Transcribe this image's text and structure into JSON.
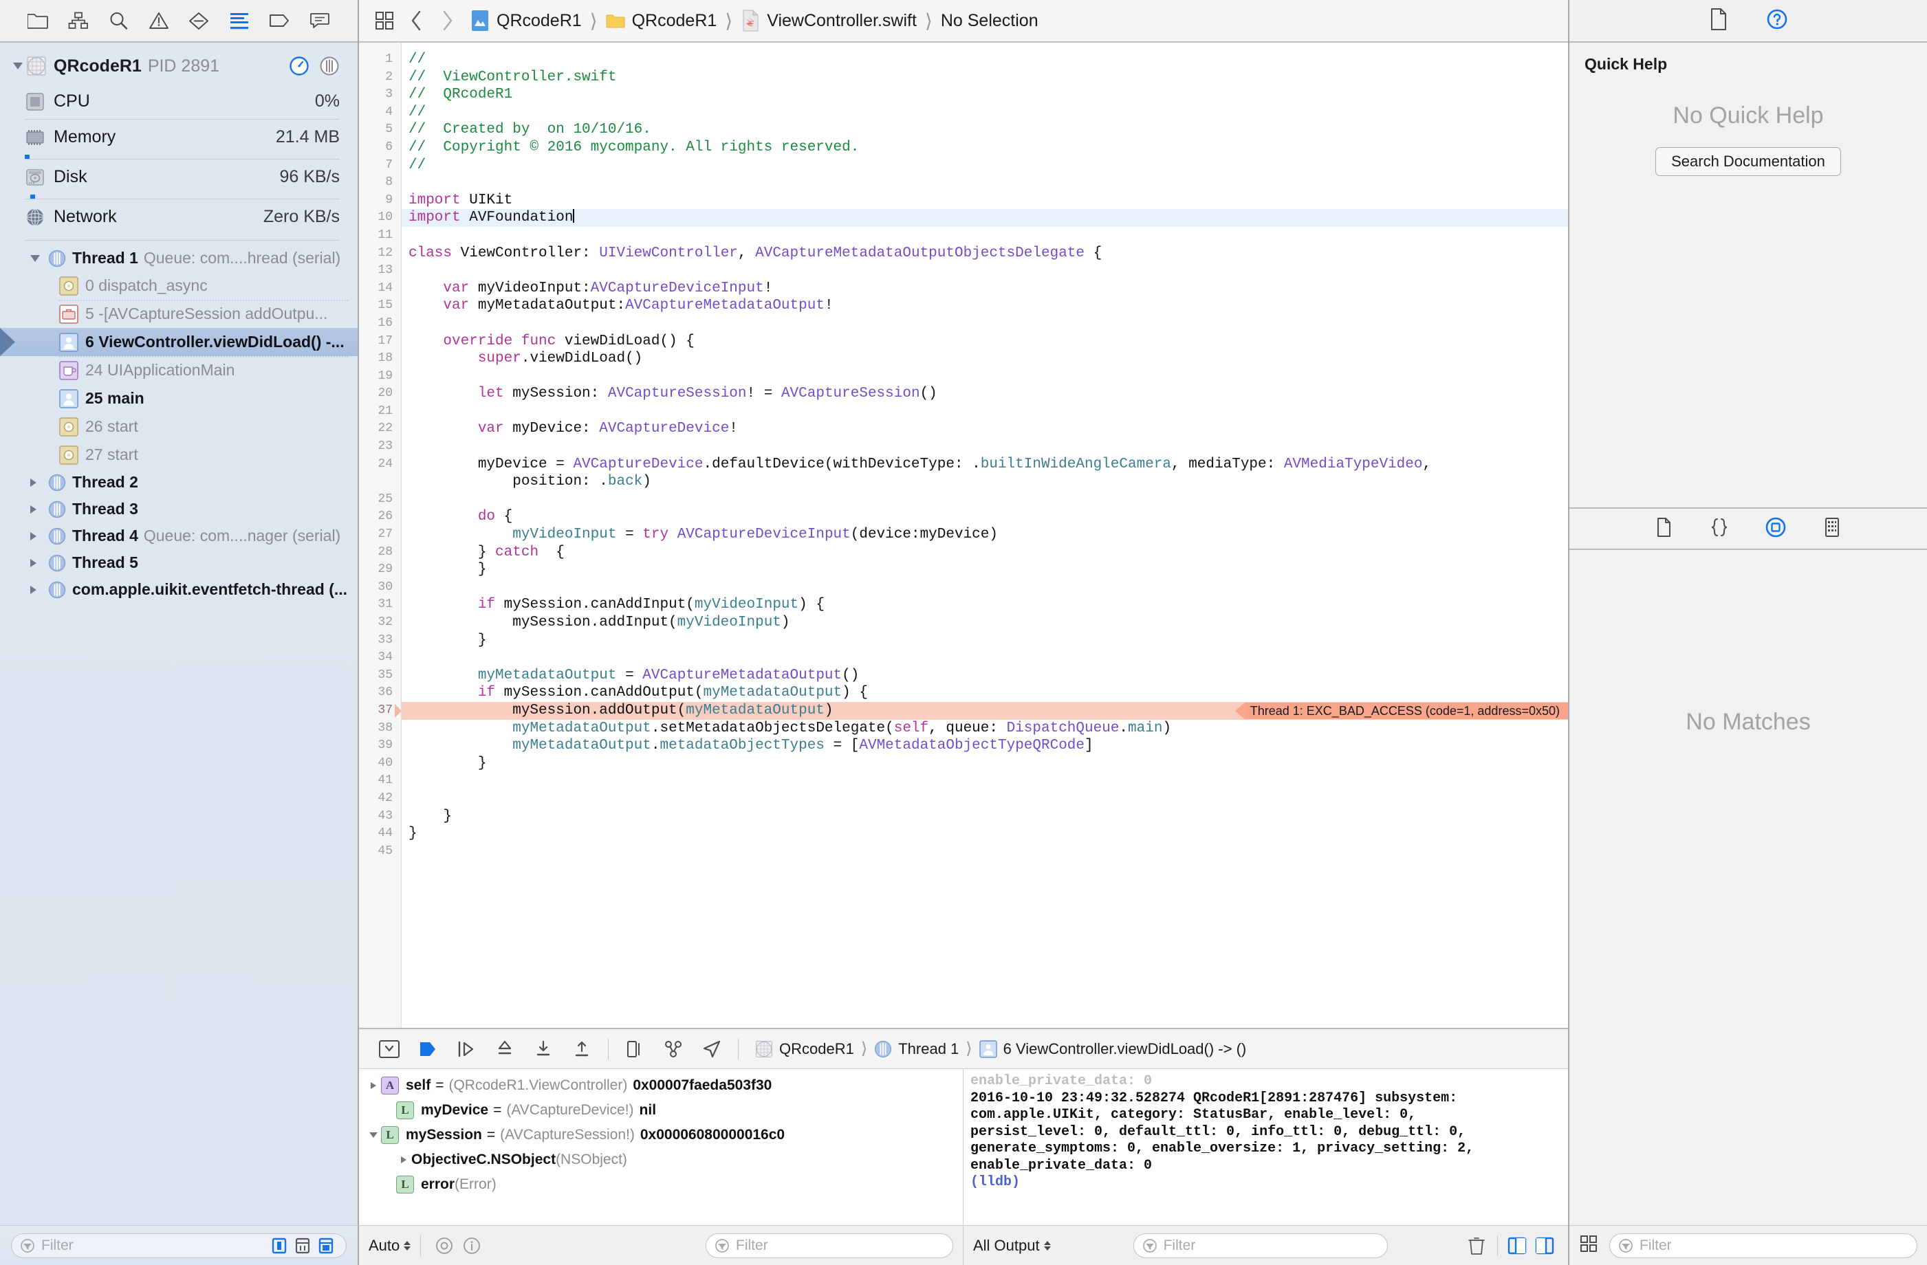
{
  "navigator": {
    "tabs": [
      {
        "name": "folder-icon",
        "label": "Project navigator"
      },
      {
        "name": "hierarchy-icon",
        "label": "Source control navigator"
      },
      {
        "name": "search-icon",
        "label": "Find navigator"
      },
      {
        "name": "warning-triangle-icon",
        "label": "Issue navigator"
      },
      {
        "name": "test-diamond-icon",
        "label": "Test navigator"
      },
      {
        "name": "debug-list-icon",
        "label": "Debug navigator"
      },
      {
        "name": "tag-icon",
        "label": "Breakpoint navigator"
      },
      {
        "name": "speech-bubble-icon",
        "label": "Report navigator"
      }
    ],
    "selected_tab": 5,
    "process": {
      "name": "QRcodeR1",
      "pid_label": "PID 2891",
      "gauge_icon": "gauge-icon",
      "threads_icon": "threads-icon"
    },
    "gauges": [
      {
        "icon": "cpu-icon",
        "label": "CPU",
        "value": "0%",
        "meter": 0
      },
      {
        "icon": "memory-icon",
        "label": "Memory",
        "value": "21.4 MB",
        "meter": 2
      },
      {
        "icon": "disk-icon",
        "label": "Disk",
        "value": "96 KB/s",
        "meter": 2
      },
      {
        "icon": "network-icon",
        "label": "Network",
        "value": "Zero KB/s",
        "meter": 0
      }
    ],
    "threads": [
      {
        "name": "Thread 1",
        "queue": "Queue: com....hread (serial)",
        "expanded": true,
        "frames": [
          {
            "num": "0",
            "label": "dispatch_async",
            "icon": "gear-frame-icon",
            "style": "gray",
            "divider": false
          },
          {
            "num": "5",
            "label": "-[AVCaptureSession addOutpu...",
            "icon": "library-frame-icon",
            "style": "gray",
            "divider": true
          },
          {
            "num": "6",
            "label": "ViewController.viewDidLoad() -...",
            "icon": "user-frame-icon",
            "style": "selected",
            "divider": false
          },
          {
            "num": "24",
            "label": "UIApplicationMain",
            "icon": "coffee-frame-icon",
            "style": "gray",
            "divider": true
          },
          {
            "num": "25",
            "label": "main",
            "icon": "user-frame-icon",
            "style": "dark",
            "divider": false
          },
          {
            "num": "26",
            "label": "start",
            "icon": "gear-frame-icon",
            "style": "gray",
            "divider": false
          },
          {
            "num": "27",
            "label": "start",
            "icon": "gear-frame-icon",
            "style": "gray",
            "divider": false
          }
        ]
      },
      {
        "name": "Thread 2",
        "queue": "",
        "expanded": false,
        "frames": []
      },
      {
        "name": "Thread 3",
        "queue": "",
        "expanded": false,
        "frames": []
      },
      {
        "name": "Thread 4",
        "queue": "Queue: com....nager (serial)",
        "expanded": false,
        "frames": []
      },
      {
        "name": "Thread 5",
        "queue": "",
        "expanded": false,
        "frames": []
      },
      {
        "name": "com.apple.uikit.eventfetch-thread (...",
        "queue": "",
        "expanded": false,
        "frames": []
      }
    ],
    "filter_placeholder": "Filter"
  },
  "editor": {
    "jump_bar": {
      "related_items_icon": "related-items-icon",
      "back_icon": "chevron-left-icon",
      "forward_icon": "chevron-right-icon",
      "crumbs": [
        {
          "label": "QRcodeR1",
          "icon": "xcode-project-icon"
        },
        {
          "label": "QRcodeR1",
          "icon": "folder-icon"
        },
        {
          "label": "ViewController.swift",
          "icon": "swift-file-icon"
        },
        {
          "label": "No Selection",
          "icon": ""
        }
      ]
    },
    "first_line": 1,
    "lines": [
      {
        "n": 1,
        "tokens": [
          {
            "t": "//",
            "c": "cmt"
          }
        ]
      },
      {
        "n": 2,
        "tokens": [
          {
            "t": "//  ViewController.swift",
            "c": "cmt"
          }
        ]
      },
      {
        "n": 3,
        "tokens": [
          {
            "t": "//  QRcodeR1",
            "c": "cmt"
          }
        ]
      },
      {
        "n": 4,
        "tokens": [
          {
            "t": "//",
            "c": "cmt"
          }
        ]
      },
      {
        "n": 5,
        "tokens": [
          {
            "t": "//  Created by  on 10/10/16.",
            "c": "cmt"
          }
        ]
      },
      {
        "n": 6,
        "tokens": [
          {
            "t": "//  Copyright © 2016 mycompany. All rights reserved.",
            "c": "cmt"
          }
        ]
      },
      {
        "n": 7,
        "tokens": [
          {
            "t": "//",
            "c": "cmt"
          }
        ]
      },
      {
        "n": 8,
        "tokens": []
      },
      {
        "n": 9,
        "tokens": [
          {
            "t": "import",
            "c": "kw"
          },
          {
            "t": " UIKit",
            "c": "pln"
          }
        ]
      },
      {
        "n": 10,
        "tokens": [
          {
            "t": "import",
            "c": "kw"
          },
          {
            "t": " AVFoundation",
            "c": "pln"
          }
        ],
        "highlight": true,
        "caret": true
      },
      {
        "n": 11,
        "tokens": []
      },
      {
        "n": 12,
        "tokens": [
          {
            "t": "class",
            "c": "kw"
          },
          {
            "t": " ViewController: ",
            "c": "pln"
          },
          {
            "t": "UIViewController",
            "c": "typ"
          },
          {
            "t": ", ",
            "c": "pln"
          },
          {
            "t": "AVCaptureMetadataOutputObjectsDelegate",
            "c": "typ"
          },
          {
            "t": " {",
            "c": "pln"
          }
        ]
      },
      {
        "n": 13,
        "tokens": []
      },
      {
        "n": 14,
        "tokens": [
          {
            "t": "    ",
            "c": "pln"
          },
          {
            "t": "var",
            "c": "kw"
          },
          {
            "t": " myVideoInput:",
            "c": "pln"
          },
          {
            "t": "AVCaptureDeviceInput",
            "c": "typ"
          },
          {
            "t": "!",
            "c": "pln"
          }
        ]
      },
      {
        "n": 15,
        "tokens": [
          {
            "t": "    ",
            "c": "pln"
          },
          {
            "t": "var",
            "c": "kw"
          },
          {
            "t": " myMetadataOutput:",
            "c": "pln"
          },
          {
            "t": "AVCaptureMetadataOutput",
            "c": "typ"
          },
          {
            "t": "!",
            "c": "pln"
          }
        ]
      },
      {
        "n": 16,
        "tokens": []
      },
      {
        "n": 17,
        "tokens": [
          {
            "t": "    ",
            "c": "pln"
          },
          {
            "t": "override func",
            "c": "kw"
          },
          {
            "t": " viewDidLoad() {",
            "c": "pln"
          }
        ]
      },
      {
        "n": 18,
        "tokens": [
          {
            "t": "        ",
            "c": "pln"
          },
          {
            "t": "super",
            "c": "kw"
          },
          {
            "t": ".viewDidLoad()",
            "c": "pln"
          }
        ]
      },
      {
        "n": 19,
        "tokens": []
      },
      {
        "n": 20,
        "tokens": [
          {
            "t": "        ",
            "c": "pln"
          },
          {
            "t": "let",
            "c": "kw"
          },
          {
            "t": " mySession: ",
            "c": "pln"
          },
          {
            "t": "AVCaptureSession",
            "c": "typ"
          },
          {
            "t": "! = ",
            "c": "pln"
          },
          {
            "t": "AVCaptureSession",
            "c": "typ"
          },
          {
            "t": "()",
            "c": "pln"
          }
        ]
      },
      {
        "n": 21,
        "tokens": []
      },
      {
        "n": 22,
        "tokens": [
          {
            "t": "        ",
            "c": "pln"
          },
          {
            "t": "var",
            "c": "kw"
          },
          {
            "t": " myDevice: ",
            "c": "pln"
          },
          {
            "t": "AVCaptureDevice",
            "c": "typ"
          },
          {
            "t": "!",
            "c": "pln"
          }
        ]
      },
      {
        "n": 23,
        "tokens": []
      },
      {
        "n": 24,
        "tokens": [
          {
            "t": "        myDevice = ",
            "c": "pln"
          },
          {
            "t": "AVCaptureDevice",
            "c": "typ"
          },
          {
            "t": ".defaultDevice(withDeviceType: .",
            "c": "pln"
          },
          {
            "t": "builtInWideAngleCamera",
            "c": "mem"
          },
          {
            "t": ", mediaType: ",
            "c": "pln"
          },
          {
            "t": "AVMediaTypeVideo",
            "c": "typ"
          },
          {
            "t": ",",
            "c": "pln"
          }
        ]
      },
      {
        "n": 0,
        "tokens": [
          {
            "t": "            position: .",
            "c": "pln"
          },
          {
            "t": "back",
            "c": "mem"
          },
          {
            "t": ")",
            "c": "pln"
          }
        ],
        "continuation": true
      },
      {
        "n": 25,
        "tokens": []
      },
      {
        "n": 26,
        "tokens": [
          {
            "t": "        ",
            "c": "pln"
          },
          {
            "t": "do",
            "c": "kw"
          },
          {
            "t": " {",
            "c": "pln"
          }
        ]
      },
      {
        "n": 27,
        "tokens": [
          {
            "t": "            ",
            "c": "pln"
          },
          {
            "t": "myVideoInput",
            "c": "mem"
          },
          {
            "t": " = ",
            "c": "pln"
          },
          {
            "t": "try",
            "c": "kw"
          },
          {
            "t": " ",
            "c": "pln"
          },
          {
            "t": "AVCaptureDeviceInput",
            "c": "typ"
          },
          {
            "t": "(device:myDevice)",
            "c": "pln"
          }
        ]
      },
      {
        "n": 28,
        "tokens": [
          {
            "t": "        } ",
            "c": "pln"
          },
          {
            "t": "catch",
            "c": "kw"
          },
          {
            "t": "  {",
            "c": "pln"
          }
        ]
      },
      {
        "n": 29,
        "tokens": [
          {
            "t": "        }",
            "c": "pln"
          }
        ]
      },
      {
        "n": 30,
        "tokens": []
      },
      {
        "n": 31,
        "tokens": [
          {
            "t": "        ",
            "c": "pln"
          },
          {
            "t": "if",
            "c": "kw"
          },
          {
            "t": " mySession.canAddInput(",
            "c": "pln"
          },
          {
            "t": "myVideoInput",
            "c": "mem"
          },
          {
            "t": ") {",
            "c": "pln"
          }
        ]
      },
      {
        "n": 32,
        "tokens": [
          {
            "t": "            mySession.addInput(",
            "c": "pln"
          },
          {
            "t": "myVideoInput",
            "c": "mem"
          },
          {
            "t": ")",
            "c": "pln"
          }
        ]
      },
      {
        "n": 33,
        "tokens": [
          {
            "t": "        }",
            "c": "pln"
          }
        ]
      },
      {
        "n": 34,
        "tokens": []
      },
      {
        "n": 35,
        "tokens": [
          {
            "t": "        ",
            "c": "pln"
          },
          {
            "t": "myMetadataOutput",
            "c": "mem"
          },
          {
            "t": " = ",
            "c": "pln"
          },
          {
            "t": "AVCaptureMetadataOutput",
            "c": "typ"
          },
          {
            "t": "()",
            "c": "pln"
          }
        ]
      },
      {
        "n": 36,
        "tokens": [
          {
            "t": "        ",
            "c": "pln"
          },
          {
            "t": "if",
            "c": "kw"
          },
          {
            "t": " mySession.canAddOutput(",
            "c": "pln"
          },
          {
            "t": "myMetadataOutput",
            "c": "mem"
          },
          {
            "t": ") {",
            "c": "pln"
          }
        ]
      },
      {
        "n": 37,
        "tokens": [
          {
            "t": "            mySession.addOutput(",
            "c": "pln"
          },
          {
            "t": "myMetadataOutput",
            "c": "mem"
          },
          {
            "t": ")",
            "c": "pln"
          }
        ],
        "error": true
      },
      {
        "n": 38,
        "tokens": [
          {
            "t": "            ",
            "c": "pln"
          },
          {
            "t": "myMetadataOutput",
            "c": "mem"
          },
          {
            "t": ".setMetadataObjectsDelegate(",
            "c": "pln"
          },
          {
            "t": "self",
            "c": "kw"
          },
          {
            "t": ", queue: ",
            "c": "pln"
          },
          {
            "t": "DispatchQueue",
            "c": "typ"
          },
          {
            "t": ".",
            "c": "pln"
          },
          {
            "t": "main",
            "c": "mem"
          },
          {
            "t": ")",
            "c": "pln"
          }
        ]
      },
      {
        "n": 39,
        "tokens": [
          {
            "t": "            ",
            "c": "pln"
          },
          {
            "t": "myMetadataOutput",
            "c": "mem"
          },
          {
            "t": ".",
            "c": "pln"
          },
          {
            "t": "metadataObjectTypes",
            "c": "mem"
          },
          {
            "t": " = [",
            "c": "pln"
          },
          {
            "t": "AVMetadataObjectTypeQRCode",
            "c": "typ"
          },
          {
            "t": "]",
            "c": "pln"
          }
        ]
      },
      {
        "n": 40,
        "tokens": [
          {
            "t": "        }",
            "c": "pln"
          }
        ]
      },
      {
        "n": 41,
        "tokens": []
      },
      {
        "n": 42,
        "tokens": []
      },
      {
        "n": 43,
        "tokens": [
          {
            "t": "    }",
            "c": "pln"
          }
        ]
      },
      {
        "n": 44,
        "tokens": [
          {
            "t": "}",
            "c": "pln"
          }
        ]
      },
      {
        "n": 45,
        "tokens": []
      }
    ],
    "error_badge": "Thread 1: EXC_BAD_ACCESS (code=1, address=0x50)"
  },
  "debug": {
    "toolbar": {
      "hide_debug_icon": "hide-debug-area-icon",
      "continue_icon": "continue-icon",
      "step_over_icon": "step-over-icon",
      "step_into_icon": "step-into-icon",
      "step_out_icon": "step-out-icon",
      "thread_icon": "step-out-up-icon",
      "view_debug_icon": "view-debugging-icon",
      "memory_graph_icon": "memory-graph-icon",
      "location_icon": "simulate-location-icon",
      "crumbs": [
        {
          "label": "QRcodeR1",
          "icon": "process-icon"
        },
        {
          "label": "Thread 1",
          "icon": "thread-icon"
        },
        {
          "label": "6 ViewController.viewDidLoad() -> ()",
          "icon": "user-frame-icon"
        }
      ]
    },
    "variables": [
      {
        "indent": 0,
        "tri": "closed",
        "badge": "A",
        "badge_class": "vb-A",
        "name": "self",
        "type": "(QRcodeR1.ViewController)",
        "value": "0x00007faeda503f30"
      },
      {
        "indent": 1,
        "tri": "none",
        "badge": "L",
        "badge_class": "vb-L",
        "name": "myDevice",
        "type": "(AVCaptureDevice!)",
        "value": "nil"
      },
      {
        "indent": 0,
        "tri": "open",
        "badge": "L",
        "badge_class": "vb-L",
        "name": "mySession",
        "type": "(AVCaptureSession!)",
        "value": "0x00006080000016c0"
      },
      {
        "indent": 2,
        "tri": "closed",
        "badge": "",
        "badge_class": "",
        "name": "ObjectiveC.NSObject",
        "type": "(NSObject)",
        "value": ""
      },
      {
        "indent": 1,
        "tri": "none",
        "badge": "L",
        "badge_class": "vb-L",
        "name": "error",
        "type": "(Error)",
        "value": ""
      }
    ],
    "console": [
      {
        "text": "enable_private_data: 0",
        "style": "faded"
      },
      {
        "text": "2016-10-10 23:49:32.528274 QRcodeR1[2891:287476] subsystem:",
        "style": "normal"
      },
      {
        "text": "com.apple.UIKit, category: StatusBar, enable_level: 0,",
        "style": "normal"
      },
      {
        "text": "persist_level: 0, default_ttl: 0, info_ttl: 0, debug_ttl: 0,",
        "style": "normal"
      },
      {
        "text": "generate_symptoms: 0, enable_oversize: 1, privacy_setting: 2,",
        "style": "normal"
      },
      {
        "text": "enable_private_data: 0",
        "style": "normal"
      },
      {
        "text": "(lldb)",
        "style": "lldb"
      }
    ],
    "status": {
      "scope_popup": "Auto",
      "watch_icon": "watch-icon",
      "info_icon": "info-icon",
      "variables_filter_placeholder": "Filter",
      "output_popup": "All Output",
      "console_filter_placeholder": "Filter",
      "trash_icon": "trash-icon",
      "split_left_icon": "show-variables-icon",
      "split_right_icon": "show-console-icon"
    }
  },
  "utilities": {
    "toolbar": [
      {
        "name": "file-inspector-icon",
        "selected": false
      },
      {
        "name": "quick-help-inspector-icon",
        "selected": true
      }
    ],
    "quick_help": {
      "title": "Quick Help",
      "empty_text": "No Quick Help",
      "search_button": "Search Documentation"
    },
    "library_toolbar": [
      {
        "name": "file-template-library-icon",
        "selected": false
      },
      {
        "name": "code-snippet-library-icon",
        "selected": false
      },
      {
        "name": "object-library-icon",
        "selected": true
      },
      {
        "name": "media-library-icon",
        "selected": false
      }
    ],
    "library_empty": "No Matches",
    "status": {
      "grid_view_icon": "grid-view-icon",
      "filter_placeholder": "Filter"
    }
  },
  "colors": {
    "accent_blue": "#1473e6",
    "error_red": "#f9a58c",
    "comment_green": "#1c8a3f",
    "keyword_magenta": "#b2349b",
    "type_purple": "#6e4ec9",
    "member_teal": "#3a7e90",
    "selection_blue": "#b4c8e4"
  }
}
